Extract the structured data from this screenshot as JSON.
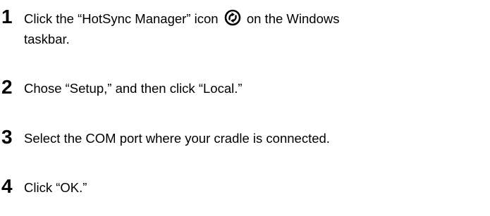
{
  "steps": [
    {
      "number": "1",
      "text_before_icon": "Click the “HotSync Manager” icon",
      "icon": "hotsync-icon",
      "text_after_icon": "on the Windows",
      "text_line2": "taskbar."
    },
    {
      "number": "2",
      "text": "Chose “Setup,” and then click “Local.”"
    },
    {
      "number": "3",
      "text": "Select the COM port where your cradle is connected."
    },
    {
      "number": "4",
      "text": "Click “OK.”"
    }
  ]
}
